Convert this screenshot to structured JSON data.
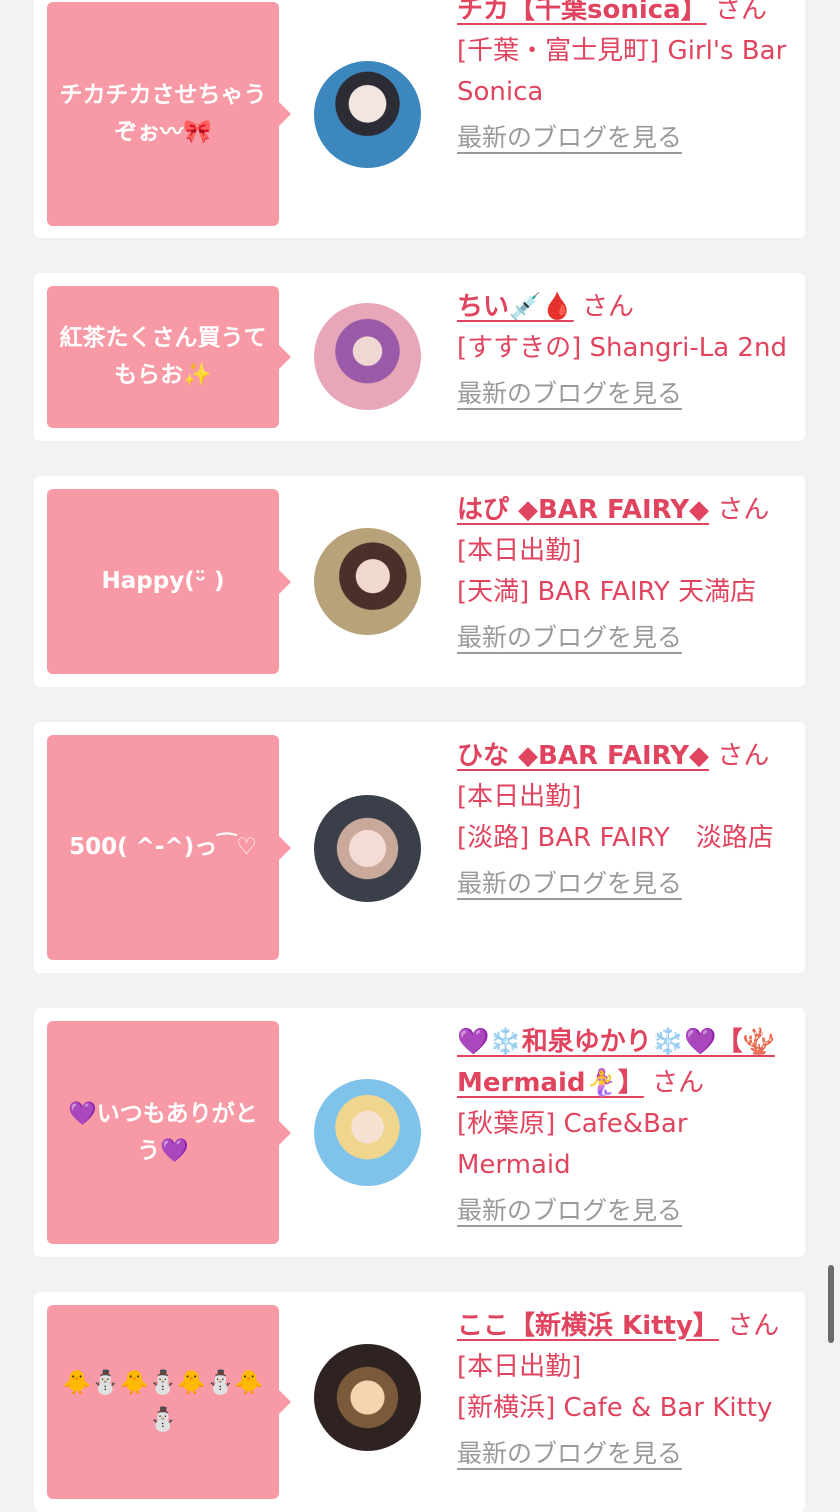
{
  "cards": [
    {
      "bubble_text": "チカチカさせちゃうぞぉ〰🎀",
      "name": "チカ【千葉sonica】",
      "san": "さん",
      "line1": "[千葉・富士見町] Girl's Bar Sonica",
      "line2": "",
      "blog": "最新のブログを見る"
    },
    {
      "bubble_text": "紅茶たくさん買うてもらお✨",
      "name": "ちい💉🩸",
      "san": "さん",
      "line1": "[すすきの] Shangri-La 2nd",
      "line2": "",
      "blog": "最新のブログを見る"
    },
    {
      "bubble_text": "Happy(ᵕ̈ )",
      "name": "はぴ ◆BAR FAIRY◆",
      "san": "さん",
      "line1": "[本日出勤]",
      "line2": "[天満] BAR FAIRY 天満店",
      "blog": "最新のブログを見る"
    },
    {
      "bubble_text": "500( ^-^)っ⁀♡",
      "name": "ひな ◆BAR FAIRY◆",
      "san": "さん",
      "line1": "[本日出勤]",
      "line2": "[淡路] BAR FAIRY　淡路店",
      "blog": "最新のブログを見る"
    },
    {
      "bubble_text": "💜いつもありがとう💜",
      "name": "💜❄️和泉ゆかり❄️💜【🪸Mermaid🧜‍♀️】",
      "san": "さん",
      "line1": "[秋葉原] Cafe&Bar Mermaid",
      "line2": "",
      "blog": "最新のブログを見る"
    },
    {
      "bubble_text": "🐥⛄🐥⛄🐥⛄🐥⛄",
      "name": "ここ【新横浜 Kitty】",
      "san": "さん",
      "line1": "[本日出勤]",
      "line2": "[新横浜] Cafe & Bar Kitty",
      "blog": "最新のブログを見る"
    }
  ],
  "colors": {
    "accent": "#e0445f",
    "bubble": "#f79aa6",
    "background": "#f2f2f4",
    "muted": "#9a9a9a"
  }
}
